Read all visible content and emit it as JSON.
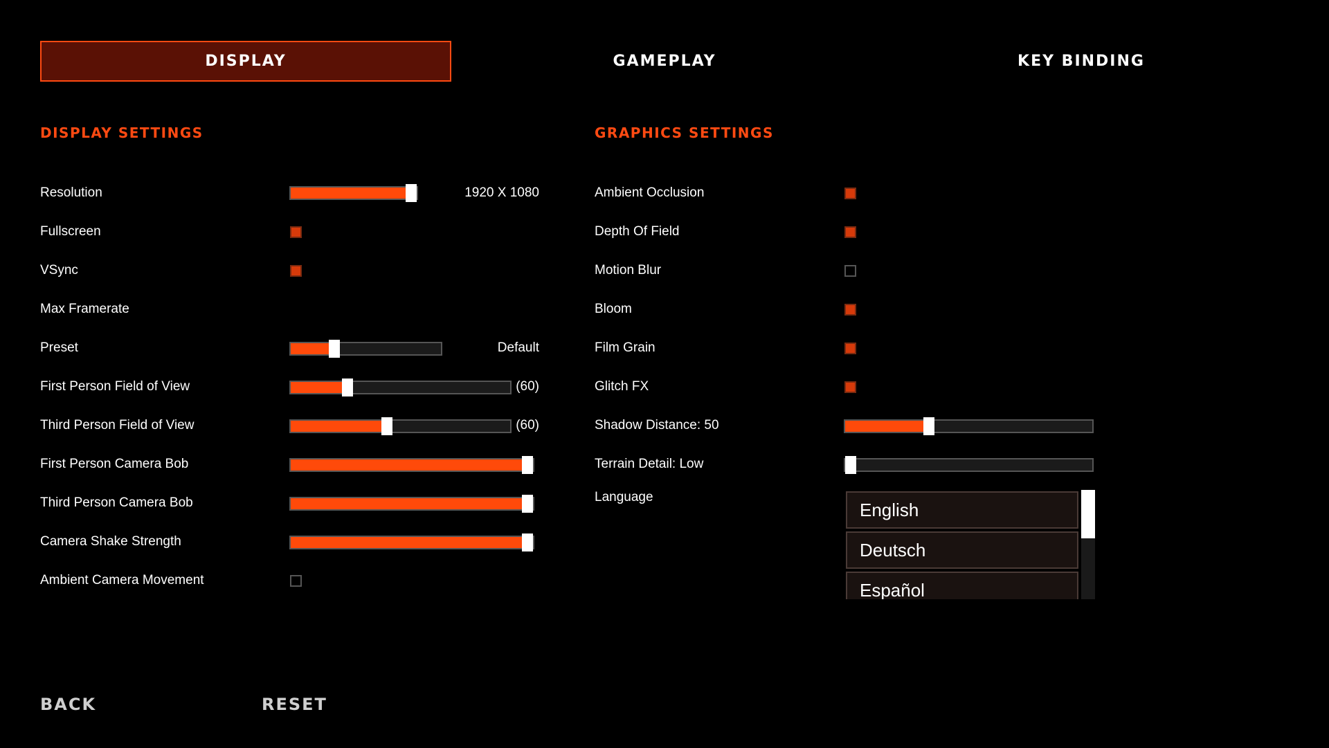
{
  "tabs": {
    "display": "DISPLAY",
    "gameplay": "GAMEPLAY",
    "key_binding": "KEY BINDING"
  },
  "display_settings": {
    "title": "DISPLAY SETTINGS",
    "resolution": {
      "label": "Resolution",
      "value": "1920 X 1080",
      "level": 0.96
    },
    "fullscreen": {
      "label": "Fullscreen",
      "checked": true
    },
    "vsync": {
      "label": "VSync",
      "checked": true
    },
    "max_framerate": {
      "label": "Max Framerate"
    },
    "preset": {
      "label": "Preset",
      "value": "Default",
      "level": 0.29
    },
    "fp_fov": {
      "label": "First Person Field of View",
      "value": "(60)",
      "level": 0.26
    },
    "tp_fov": {
      "label": "Third Person Field of View",
      "value": "(60)",
      "level": 0.44
    },
    "fp_camera_bob": {
      "label": "First Person Camera Bob",
      "level": 1.0
    },
    "tp_camera_bob": {
      "label": "Third Person Camera Bob",
      "level": 1.0
    },
    "camera_shake": {
      "label": "Camera Shake Strength",
      "level": 1.0
    },
    "ambient_camera": {
      "label": "Ambient Camera Movement",
      "checked": false
    }
  },
  "graphics_settings": {
    "title": "GRAPHICS SETTINGS",
    "ambient_occlusion": {
      "label": "Ambient Occlusion",
      "checked": true
    },
    "depth_of_field": {
      "label": "Depth Of Field",
      "checked": true
    },
    "motion_blur": {
      "label": "Motion Blur",
      "checked": false
    },
    "bloom": {
      "label": "Bloom",
      "checked": true
    },
    "film_grain": {
      "label": "Film Grain",
      "checked": true
    },
    "glitch_fx": {
      "label": "Glitch FX",
      "checked": true
    },
    "shadow_distance": {
      "label": "Shadow Distance: 50",
      "level": 0.34
    },
    "terrain_detail": {
      "label": "Terrain Detail: Low",
      "level": 0.0
    },
    "language": {
      "label": "Language",
      "options": [
        "English",
        "Deutsch",
        "Español"
      ]
    }
  },
  "footer": {
    "back": "BACK",
    "reset": "RESET"
  },
  "colors": {
    "accent": "#ff4a12",
    "active_tab_bg": "#5a1105"
  }
}
